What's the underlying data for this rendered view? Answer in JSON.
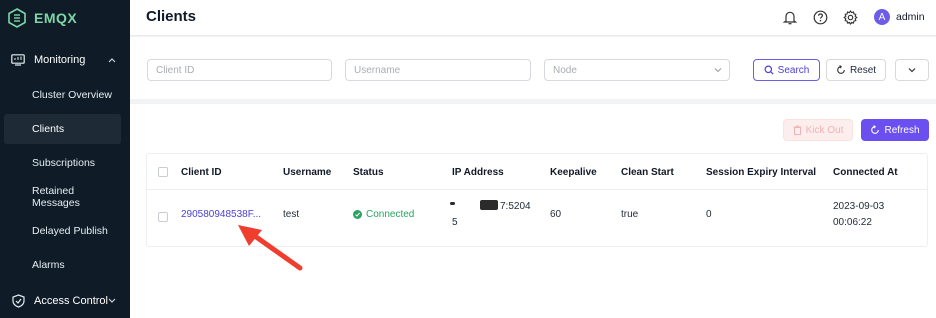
{
  "brand": {
    "name": "EMQX",
    "accent": "#7ed6a8"
  },
  "sidebar": {
    "monitoring": {
      "label": "Monitoring"
    },
    "items": [
      {
        "label": "Cluster Overview"
      },
      {
        "label": "Clients"
      },
      {
        "label": "Subscriptions"
      },
      {
        "label": "Retained Messages"
      },
      {
        "label": "Delayed Publish"
      },
      {
        "label": "Alarms"
      }
    ],
    "access_control": {
      "label": "Access Control"
    }
  },
  "header": {
    "title": "Clients",
    "icons": [
      "bell-icon",
      "help-icon",
      "gear-icon"
    ],
    "avatar_initial": "A",
    "user": "admin"
  },
  "filters": {
    "client_id_placeholder": "Client ID",
    "username_placeholder": "Username",
    "node_placeholder": "Node",
    "search_label": "Search",
    "reset_label": "Reset"
  },
  "actions": {
    "kick_out_label": "Kick Out",
    "refresh_label": "Refresh",
    "primary_color": "#6c4ff0"
  },
  "table": {
    "columns": [
      "Client ID",
      "Username",
      "Status",
      "IP Address",
      "Keepalive",
      "Clean Start",
      "Session Expiry Interval",
      "Connected At"
    ],
    "rows": [
      {
        "client_id": "290580948538F...",
        "username": "test",
        "status": "Connected",
        "ip_part1": "7:5204",
        "ip_part2": "5",
        "keepalive": "60",
        "clean_start": "true",
        "session_expiry": "0",
        "connected_date": "2023-09-03",
        "connected_time": "00:06:22"
      }
    ]
  }
}
